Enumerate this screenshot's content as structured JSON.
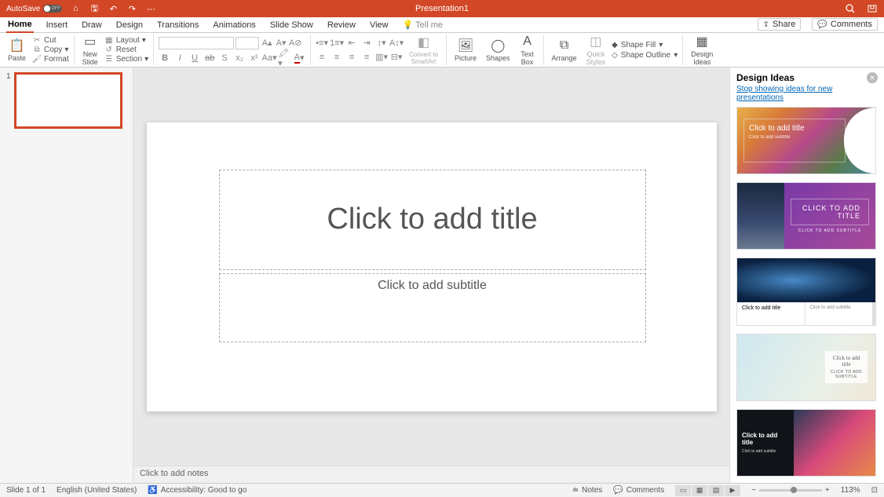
{
  "titlebar": {
    "autosave": "AutoSave",
    "toggleLabel": "OFF",
    "docTitle": "Presentation1"
  },
  "tabs": {
    "items": [
      "Home",
      "Insert",
      "Draw",
      "Design",
      "Transitions",
      "Animations",
      "Slide Show",
      "Review",
      "View"
    ],
    "tellMe": "Tell me",
    "share": "Share",
    "comments": "Comments",
    "activeIndex": 0
  },
  "ribbon": {
    "paste": "Paste",
    "cut": "Cut",
    "copy": "Copy",
    "format": "Format",
    "newSlide": "New\nSlide",
    "layout": "Layout",
    "reset": "Reset",
    "section": "Section",
    "convertTo": "Convert to\nSmartArt",
    "picture": "Picture",
    "shapes": "Shapes",
    "textBox": "Text\nBox",
    "arrange": "Arrange",
    "quickStyles": "Quick\nStyles",
    "shapeFill": "Shape Fill",
    "shapeOutline": "Shape Outline",
    "designIdeas": "Design\nIdeas"
  },
  "thumbs": {
    "num1": "1"
  },
  "slide": {
    "titlePlaceholder": "Click to add title",
    "subtitlePlaceholder": "Click to add subtitle"
  },
  "notes": {
    "placeholder": "Click to add notes"
  },
  "designPanel": {
    "title": "Design Ideas",
    "subtitle": "Stop showing ideas for new presentations",
    "ideas": [
      {
        "title": "Click to add title",
        "subtitle": "Click to add subtitle"
      },
      {
        "title": "CLICK TO ADD TITLE",
        "subtitle": "CLICK TO ADD SUBTITLE"
      },
      {
        "title": "Click to add title",
        "subtitle": "Click to add subtitle"
      },
      {
        "title": "Click to add title",
        "subtitle": "CLICK TO ADD SUBTITLE"
      },
      {
        "title": "Click to add title",
        "subtitle": "Click to add subtitle"
      }
    ]
  },
  "status": {
    "slideCount": "Slide 1 of 1",
    "language": "English (United States)",
    "accessibility": "Accessibility: Good to go",
    "notes": "Notes",
    "comments": "Comments",
    "zoom": "113%"
  }
}
